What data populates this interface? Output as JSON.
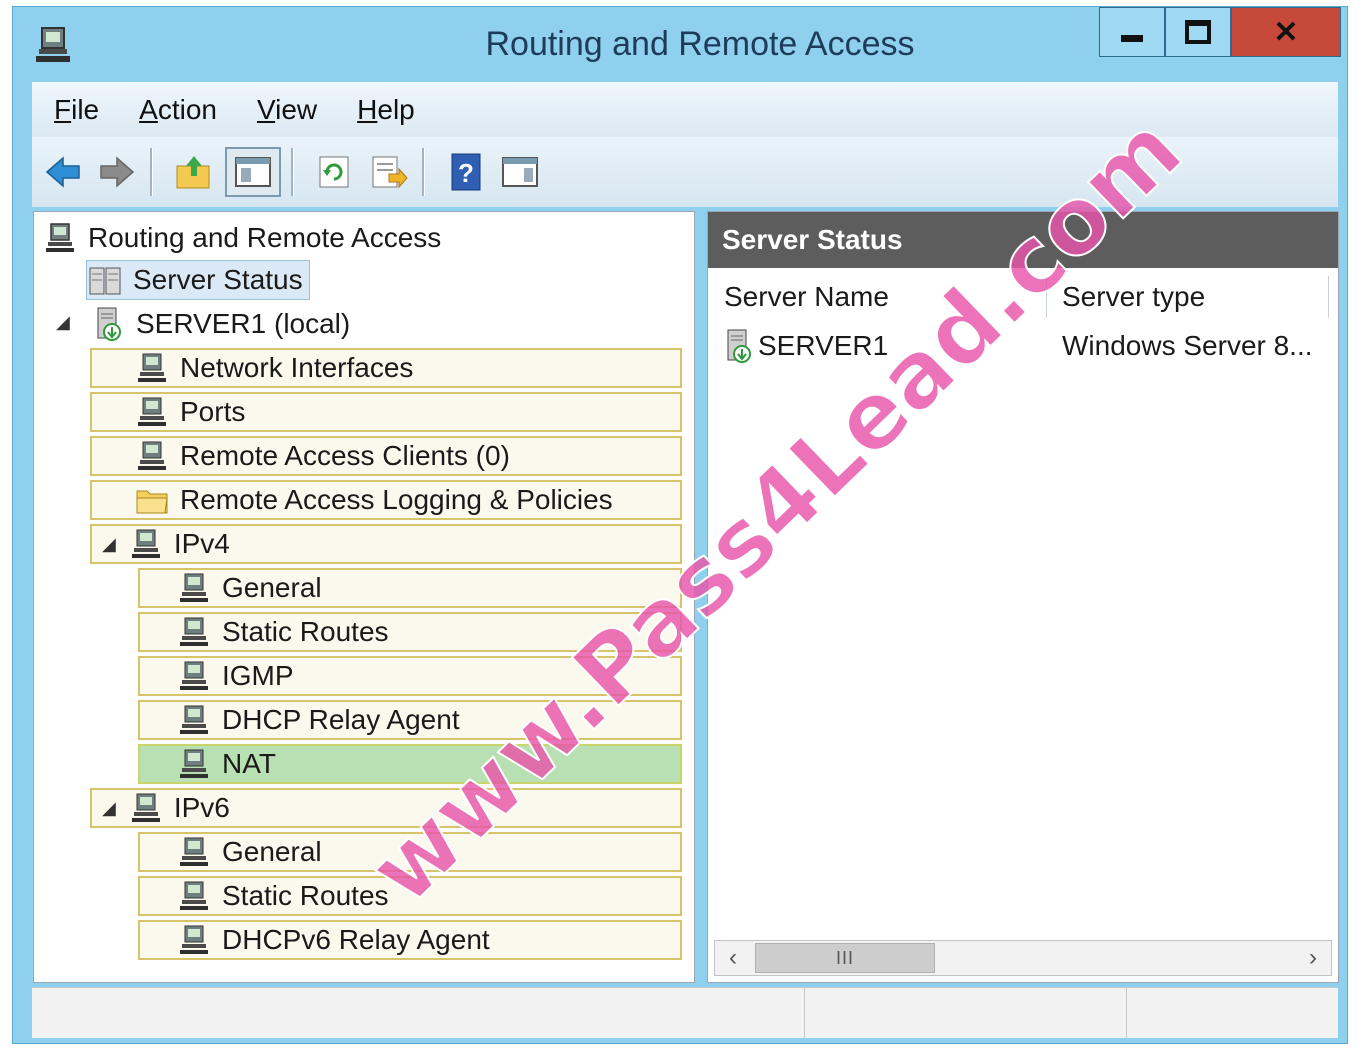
{
  "window": {
    "title": "Routing and Remote Access",
    "accent_color": "#8fd0ee",
    "close_color": "#c7493a"
  },
  "menu": [
    {
      "label": "File",
      "mnemonic": "F",
      "rest": "ile"
    },
    {
      "label": "Action",
      "mnemonic": "A",
      "rest": "ction"
    },
    {
      "label": "View",
      "mnemonic": "V",
      "rest": "iew"
    },
    {
      "label": "Help",
      "mnemonic": "H",
      "rest": "elp"
    }
  ],
  "toolbar": {
    "icons": [
      "back-arrow-icon",
      "forward-arrow-icon",
      "up-folder-icon",
      "show-hide-console-tree-icon",
      "refresh-icon",
      "export-list-icon",
      "help-icon",
      "show-hide-action-pane-icon"
    ]
  },
  "tree": {
    "root": "Routing and Remote Access",
    "server_status": "Server Status",
    "server": "SERVER1 (local)",
    "items": [
      {
        "label": "Network Interfaces"
      },
      {
        "label": "Ports"
      },
      {
        "label": "Remote Access Clients (0)"
      },
      {
        "label": "Remote Access Logging & Policies"
      }
    ],
    "ipv4": {
      "label": "IPv4",
      "children": [
        "General",
        "Static Routes",
        "IGMP",
        "DHCP Relay Agent",
        "NAT"
      ]
    },
    "ipv6": {
      "label": "IPv6",
      "children": [
        "General",
        "Static Routes",
        "DHCPv6 Relay Agent"
      ]
    },
    "selected": "NAT"
  },
  "details": {
    "header": "Server Status",
    "columns": [
      "Server Name",
      "Server type"
    ],
    "rows": [
      {
        "name": "SERVER1",
        "type": "Windows Server 8..."
      }
    ],
    "scroll_thumb": "III"
  },
  "watermark": "www.Pass4Lead.com"
}
